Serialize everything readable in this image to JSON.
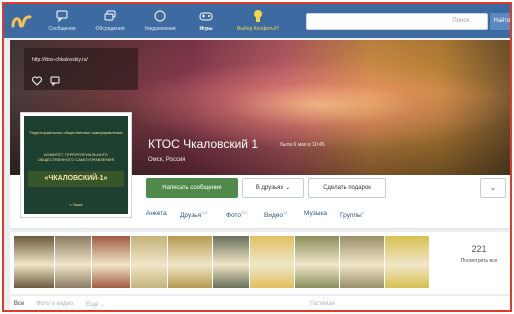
{
  "nav": {
    "items": [
      {
        "label": "Сообщения",
        "icon": "chat-icon"
      },
      {
        "label": "Обсуждения",
        "icon": "comments-icon"
      },
      {
        "label": "Уведомления",
        "icon": "bell-icon"
      },
      {
        "label": "Игры",
        "icon": "gamepad-icon"
      },
      {
        "label": "Выбор Конфеты!!!",
        "icon": "gift-icon"
      }
    ],
    "search_placeholder": "Поиск",
    "search_button": "Найти"
  },
  "cover": {
    "link": "http://ktos-chkalovskiy.ru/",
    "name": "КТОС Чкаловский 1",
    "last_seen": "была 6 мая в 10:45",
    "city": "Омск, Россия"
  },
  "avatar": {
    "title": "Территориальное общественное самоуправление",
    "middle": "КОМИТЕТ ТЕРРИТОРИАЛЬНОГО ОБЩЕСТВЕННОГО САМОУПРАВЛЕНИЯ",
    "name": "«ЧКАЛОВСКИЙ-1»",
    "city": "г. Омск"
  },
  "actions": {
    "write": "Написать сообщение",
    "friends": "В друзьях",
    "gift": "Сделать подарок",
    "more": "⌄"
  },
  "tabs": [
    {
      "label": "Анкета",
      "count": ""
    },
    {
      "label": "Друзья",
      "count": "262"
    },
    {
      "label": "Фото",
      "count": "221"
    },
    {
      "label": "Видео",
      "count": "16"
    },
    {
      "label": "Музыка",
      "count": ""
    },
    {
      "label": "Группы",
      "count": "8"
    }
  ],
  "photos": {
    "count": "221",
    "more_label": "Посмотреть все",
    "colors": [
      "#6d5a3d",
      "#8a7a62",
      "#a05a40",
      "#c5b37a",
      "#b79a50",
      "#6a6f59",
      "#e0c060",
      "#8a8f5a",
      "#9a8f6a",
      "#d8c050",
      "#7a8a5a"
    ]
  },
  "bottom": {
    "items": [
      "Все",
      "Фото и видео",
      "Ещё",
      "Гостевая"
    ]
  },
  "colors": {
    "nav": "#3d6aa0",
    "primary_button": "#4f8a4a",
    "link": "#2a5885",
    "frame": "#e23a2a"
  }
}
